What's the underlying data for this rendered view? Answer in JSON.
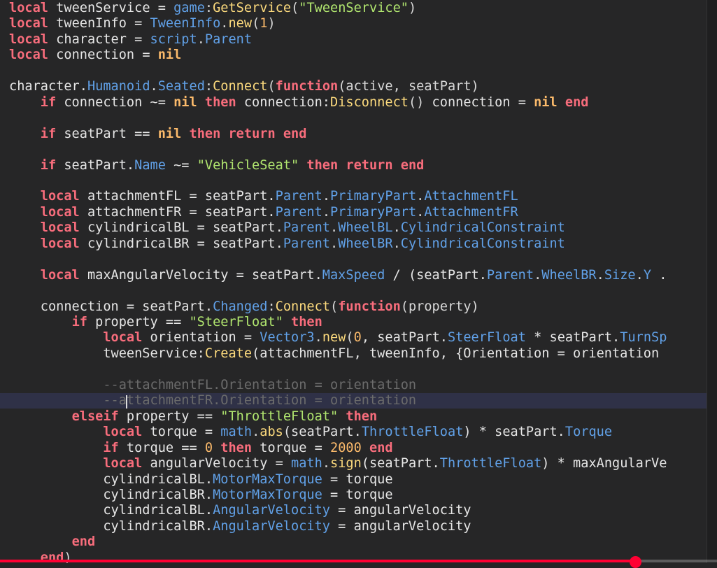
{
  "colors": {
    "background": "#262627",
    "keyword": "#f86d7c",
    "identifier": "#e6e6e6",
    "property": "#61a1e8",
    "function": "#fcda7d",
    "string": "#b1e66f",
    "number": "#fbba6b",
    "comment": "#6b6b6b",
    "current_line": "#2f3147",
    "progress": "#ff0033"
  },
  "editor": {
    "current_line_index": 25,
    "lines": [
      [
        [
          "kw",
          "local"
        ],
        [
          "id",
          " tweenService = "
        ],
        [
          "prop",
          "game"
        ],
        [
          "op",
          ":"
        ],
        [
          "fn",
          "GetService"
        ],
        [
          "op",
          "("
        ],
        [
          "str",
          "\"TweenService\""
        ],
        [
          "op",
          ")"
        ]
      ],
      [
        [
          "kw",
          "local"
        ],
        [
          "id",
          " tweenInfo = "
        ],
        [
          "prop",
          "TweenInfo"
        ],
        [
          "op",
          "."
        ],
        [
          "fn",
          "new"
        ],
        [
          "op",
          "("
        ],
        [
          "num",
          "1"
        ],
        [
          "op",
          ")"
        ]
      ],
      [
        [
          "kw",
          "local"
        ],
        [
          "id",
          " character = "
        ],
        [
          "prop",
          "script"
        ],
        [
          "op",
          "."
        ],
        [
          "prop",
          "Parent"
        ]
      ],
      [
        [
          "kw",
          "local"
        ],
        [
          "id",
          " connection = "
        ],
        [
          "nil",
          "nil"
        ]
      ],
      [],
      [
        [
          "id",
          "character."
        ],
        [
          "prop",
          "Humanoid"
        ],
        [
          "op",
          "."
        ],
        [
          "prop",
          "Seated"
        ],
        [
          "op",
          ":"
        ],
        [
          "fn",
          "Connect"
        ],
        [
          "op",
          "("
        ],
        [
          "kw",
          "function"
        ],
        [
          "op",
          "(active, seatPart)"
        ]
      ],
      [
        [
          "id",
          "    "
        ],
        [
          "kw",
          "if"
        ],
        [
          "id",
          " connection ~= "
        ],
        [
          "nil",
          "nil"
        ],
        [
          "id",
          " "
        ],
        [
          "kw",
          "then"
        ],
        [
          "id",
          " connection:"
        ],
        [
          "fn",
          "Disconnect"
        ],
        [
          "op",
          "()"
        ],
        [
          "id",
          " connection = "
        ],
        [
          "nil",
          "nil"
        ],
        [
          "id",
          " "
        ],
        [
          "kw",
          "end"
        ]
      ],
      [],
      [
        [
          "id",
          "    "
        ],
        [
          "kw",
          "if"
        ],
        [
          "id",
          " seatPart == "
        ],
        [
          "nil",
          "nil"
        ],
        [
          "id",
          " "
        ],
        [
          "kw",
          "then"
        ],
        [
          "id",
          " "
        ],
        [
          "kw",
          "return"
        ],
        [
          "id",
          " "
        ],
        [
          "kw",
          "end"
        ]
      ],
      [],
      [
        [
          "id",
          "    "
        ],
        [
          "kw",
          "if"
        ],
        [
          "id",
          " seatPart."
        ],
        [
          "prop",
          "Name"
        ],
        [
          "id",
          " ~= "
        ],
        [
          "str",
          "\"VehicleSeat\""
        ],
        [
          "id",
          " "
        ],
        [
          "kw",
          "then"
        ],
        [
          "id",
          " "
        ],
        [
          "kw",
          "return"
        ],
        [
          "id",
          " "
        ],
        [
          "kw",
          "end"
        ]
      ],
      [],
      [
        [
          "id",
          "    "
        ],
        [
          "kw",
          "local"
        ],
        [
          "id",
          " attachmentFL = seatPart."
        ],
        [
          "prop",
          "Parent"
        ],
        [
          "op",
          "."
        ],
        [
          "prop",
          "PrimaryPart"
        ],
        [
          "op",
          "."
        ],
        [
          "prop",
          "AttachmentFL"
        ]
      ],
      [
        [
          "id",
          "    "
        ],
        [
          "kw",
          "local"
        ],
        [
          "id",
          " attachmentFR = seatPart."
        ],
        [
          "prop",
          "Parent"
        ],
        [
          "op",
          "."
        ],
        [
          "prop",
          "PrimaryPart"
        ],
        [
          "op",
          "."
        ],
        [
          "prop",
          "AttachmentFR"
        ]
      ],
      [
        [
          "id",
          "    "
        ],
        [
          "kw",
          "local"
        ],
        [
          "id",
          " cylindricalBL = seatPart."
        ],
        [
          "prop",
          "Parent"
        ],
        [
          "op",
          "."
        ],
        [
          "prop",
          "WheelBL"
        ],
        [
          "op",
          "."
        ],
        [
          "prop",
          "CylindricalConstraint"
        ]
      ],
      [
        [
          "id",
          "    "
        ],
        [
          "kw",
          "local"
        ],
        [
          "id",
          " cylindricalBR = seatPart."
        ],
        [
          "prop",
          "Parent"
        ],
        [
          "op",
          "."
        ],
        [
          "prop",
          "WheelBR"
        ],
        [
          "op",
          "."
        ],
        [
          "prop",
          "CylindricalConstraint"
        ]
      ],
      [],
      [
        [
          "id",
          "    "
        ],
        [
          "kw",
          "local"
        ],
        [
          "id",
          " maxAngularVelocity = seatPart."
        ],
        [
          "prop",
          "MaxSpeed"
        ],
        [
          "id",
          " / (seatPart."
        ],
        [
          "prop",
          "Parent"
        ],
        [
          "op",
          "."
        ],
        [
          "prop",
          "WheelBR"
        ],
        [
          "op",
          "."
        ],
        [
          "prop",
          "Size"
        ],
        [
          "op",
          "."
        ],
        [
          "prop",
          "Y"
        ],
        [
          "id",
          " ."
        ]
      ],
      [],
      [
        [
          "id",
          "    connection = seatPart."
        ],
        [
          "prop",
          "Changed"
        ],
        [
          "op",
          ":"
        ],
        [
          "fn",
          "Connect"
        ],
        [
          "op",
          "("
        ],
        [
          "kw",
          "function"
        ],
        [
          "op",
          "(property)"
        ]
      ],
      [
        [
          "id",
          "        "
        ],
        [
          "kw",
          "if"
        ],
        [
          "id",
          " property == "
        ],
        [
          "str",
          "\"SteerFloat\""
        ],
        [
          "id",
          " "
        ],
        [
          "kw",
          "then"
        ]
      ],
      [
        [
          "id",
          "            "
        ],
        [
          "kw",
          "local"
        ],
        [
          "id",
          " orientation = "
        ],
        [
          "prop",
          "Vector3"
        ],
        [
          "op",
          "."
        ],
        [
          "fn",
          "new"
        ],
        [
          "op",
          "("
        ],
        [
          "num",
          "0"
        ],
        [
          "id",
          ", seatPart."
        ],
        [
          "prop",
          "SteerFloat"
        ],
        [
          "id",
          " * seatPart."
        ],
        [
          "prop",
          "TurnSp"
        ]
      ],
      [
        [
          "id",
          "            tweenService:"
        ],
        [
          "fn",
          "Create"
        ],
        [
          "id",
          "(attachmentFL, tweenInfo, {Orientation = orientation"
        ]
      ],
      [],
      [
        [
          "id",
          "            "
        ],
        [
          "cmt",
          "--attachmentFL.Orientation = orientation"
        ]
      ],
      [
        [
          "id",
          "            "
        ],
        [
          "cmt",
          "--attachmentFR.Orientation = orientation"
        ]
      ],
      [
        [
          "id",
          "        "
        ],
        [
          "kw",
          "elseif"
        ],
        [
          "id",
          " property == "
        ],
        [
          "str",
          "\"ThrottleFloat\""
        ],
        [
          "id",
          " "
        ],
        [
          "kw",
          "then"
        ]
      ],
      [
        [
          "id",
          "            "
        ],
        [
          "kw",
          "local"
        ],
        [
          "id",
          " torque = "
        ],
        [
          "prop",
          "math"
        ],
        [
          "op",
          "."
        ],
        [
          "fn",
          "abs"
        ],
        [
          "id",
          "(seatPart."
        ],
        [
          "prop",
          "ThrottleFloat"
        ],
        [
          "id",
          ") * seatPart."
        ],
        [
          "prop",
          "Torque"
        ]
      ],
      [
        [
          "id",
          "            "
        ],
        [
          "kw",
          "if"
        ],
        [
          "id",
          " torque == "
        ],
        [
          "num",
          "0"
        ],
        [
          "id",
          " "
        ],
        [
          "kw",
          "then"
        ],
        [
          "id",
          " torque = "
        ],
        [
          "num",
          "2000"
        ],
        [
          "id",
          " "
        ],
        [
          "kw",
          "end"
        ]
      ],
      [
        [
          "id",
          "            "
        ],
        [
          "kw",
          "local"
        ],
        [
          "id",
          " angularVelocity = "
        ],
        [
          "prop",
          "math"
        ],
        [
          "op",
          "."
        ],
        [
          "fn",
          "sign"
        ],
        [
          "id",
          "(seatPart."
        ],
        [
          "prop",
          "ThrottleFloat"
        ],
        [
          "id",
          ") * maxAngularVe"
        ]
      ],
      [
        [
          "id",
          "            cylindricalBL."
        ],
        [
          "prop",
          "MotorMaxTorque"
        ],
        [
          "id",
          " = torque"
        ]
      ],
      [
        [
          "id",
          "            cylindricalBR."
        ],
        [
          "prop",
          "MotorMaxTorque"
        ],
        [
          "id",
          " = torque"
        ]
      ],
      [
        [
          "id",
          "            cylindricalBL."
        ],
        [
          "prop",
          "AngularVelocity"
        ],
        [
          "id",
          " = angularVelocity"
        ]
      ],
      [
        [
          "id",
          "            cylindricalBR."
        ],
        [
          "prop",
          "AngularVelocity"
        ],
        [
          "id",
          " = angularVelocity"
        ]
      ],
      [
        [
          "id",
          "        "
        ],
        [
          "kw",
          "end"
        ]
      ],
      [
        [
          "id",
          "    "
        ],
        [
          "kw",
          "end"
        ],
        [
          "op",
          ")"
        ]
      ]
    ]
  },
  "video": {
    "progress": 0.886
  }
}
